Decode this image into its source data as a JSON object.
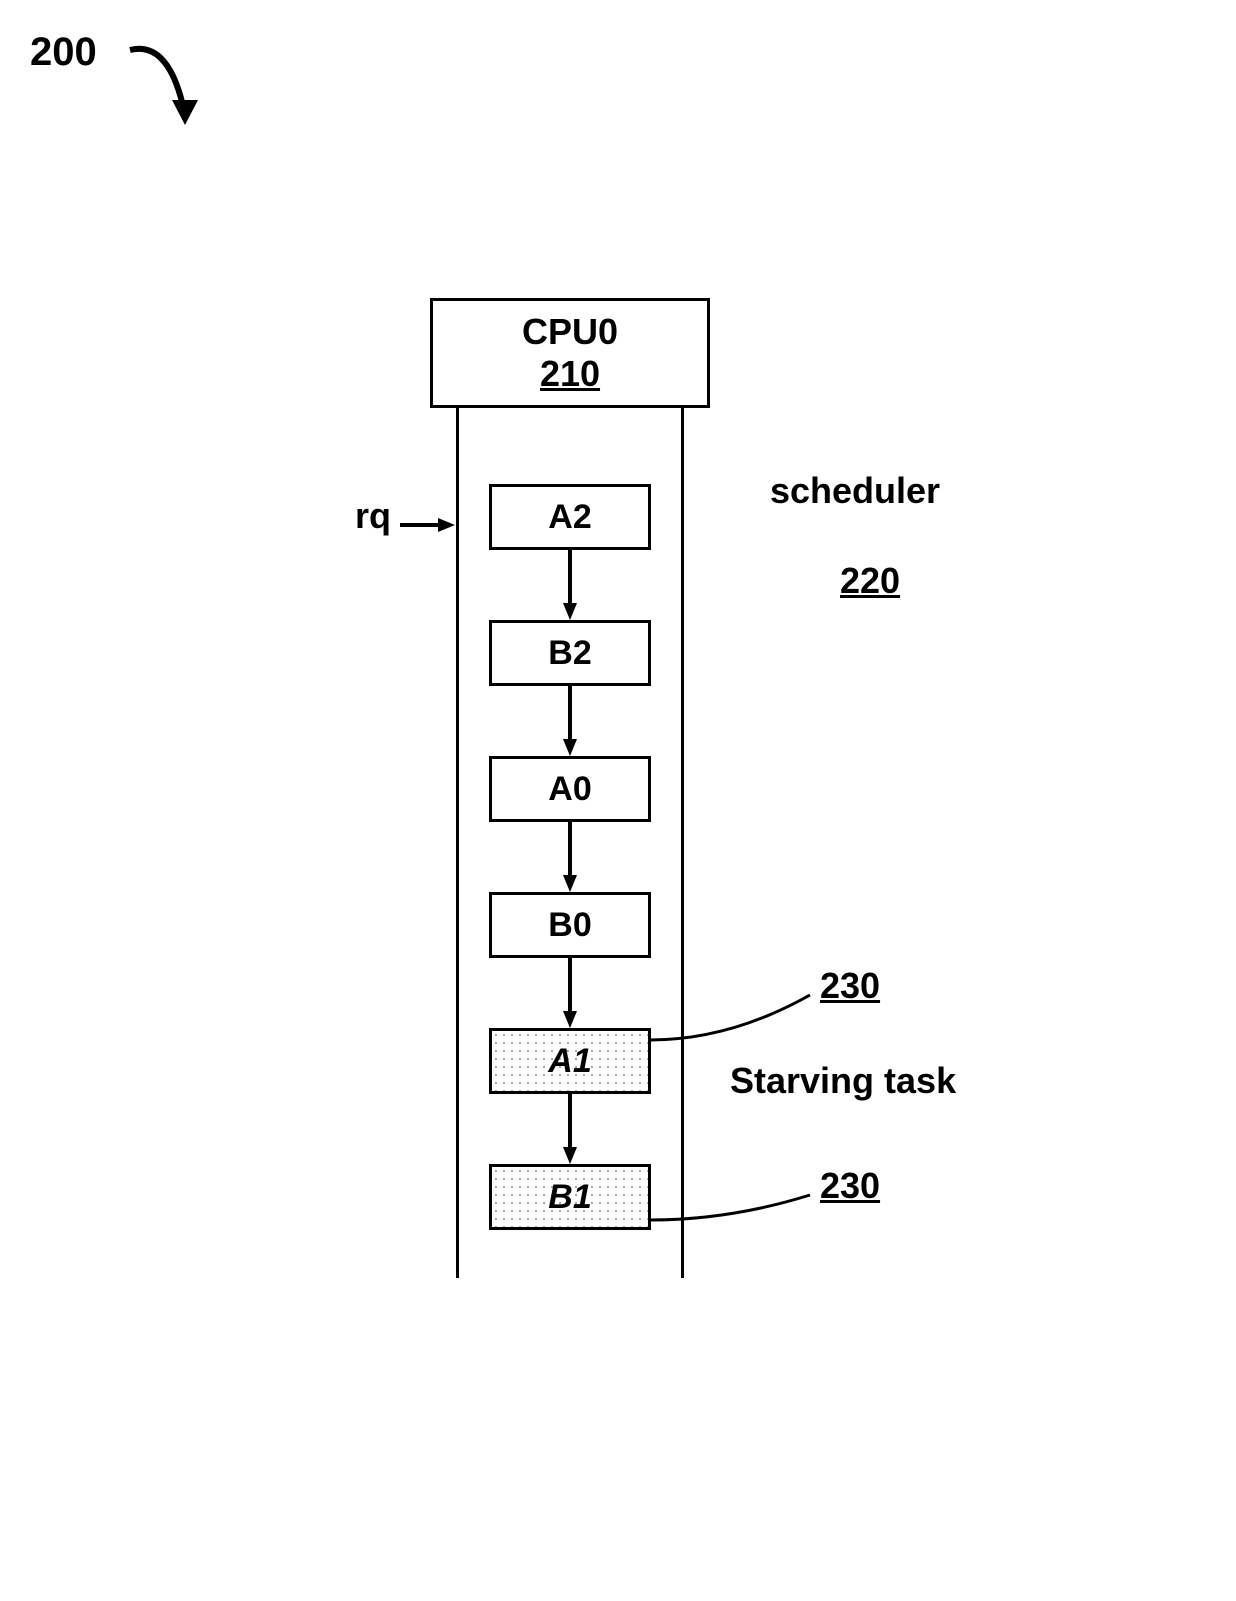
{
  "figure_ref": "200",
  "cpu": {
    "title": "CPU0",
    "ref": "210"
  },
  "rq_label": "rq",
  "scheduler": {
    "label": "scheduler",
    "ref": "220"
  },
  "starving_label": "Starving  task",
  "tasks": [
    {
      "label": "A2",
      "starving": false
    },
    {
      "label": "B2",
      "starving": false
    },
    {
      "label": "A0",
      "starving": false
    },
    {
      "label": "B0",
      "starving": false
    },
    {
      "label": "A1",
      "starving": true,
      "ref": "230"
    },
    {
      "label": "B1",
      "starving": true,
      "ref": "230"
    }
  ]
}
